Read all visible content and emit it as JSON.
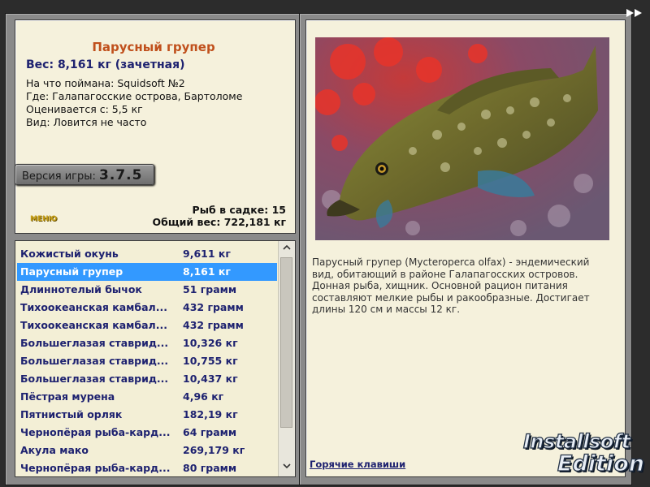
{
  "fish": {
    "title": "Парусный групер",
    "weight": "Вес: 8,161 кг (зачетная)",
    "bait": "На что поймана: Squidsoft №2",
    "place": "Где: Галапагосские острова, Бартоломе",
    "rated": "Оценивается с: 5,5 кг",
    "kind": "Вид: Ловится не часто"
  },
  "version": {
    "label": "Версия игры:",
    "number": "3.7.5"
  },
  "small_logo": "МЕНЮ",
  "stats": {
    "count": "Рыб в садке: 15",
    "total": "Общий вес: 722,181 кг"
  },
  "catch_list": [
    {
      "name": "Кожистый окунь",
      "weight": "9,611 кг"
    },
    {
      "name": "Парусный групер",
      "weight": "8,161 кг"
    },
    {
      "name": "Длиннотелый бычок",
      "weight": "51 грамм"
    },
    {
      "name": "Тихоокеанская камбал...",
      "weight": "432 грамм"
    },
    {
      "name": "Тихоокеанская камбал...",
      "weight": "432 грамм"
    },
    {
      "name": "Большеглазая ставрид...",
      "weight": "10,326 кг"
    },
    {
      "name": "Большеглазая ставрид...",
      "weight": "10,755 кг"
    },
    {
      "name": "Большеглазая ставрид...",
      "weight": "10,437 кг"
    },
    {
      "name": "Пёстрая мурена",
      "weight": "4,96 кг"
    },
    {
      "name": "Пятнистый орляк",
      "weight": "182,19 кг"
    },
    {
      "name": "Чернопёрая рыба-кард...",
      "weight": "64 грамм"
    },
    {
      "name": "Акула мако",
      "weight": "269,179 кг"
    },
    {
      "name": "Чернопёрая рыба-кард...",
      "weight": "80 грамм"
    }
  ],
  "selected_index": 1,
  "description": "Парусный групер (Mycteroperca olfax) - эндемический вид, обитающий в районе Галапагосских островов. Донная рыба, хищник. Основной рацион питания составляют мелкие рыбы и ракообразные. Достигает длины 120 см и массы 12 кг.",
  "hotkeys_link": "Горячие клавиши",
  "brand": {
    "line1": "Installsoft",
    "line2": "Edition"
  },
  "icons": {
    "forward": "fast-forward-icon",
    "scroll_up": "chevron-up-icon",
    "scroll_down": "chevron-down-icon"
  },
  "colors": {
    "panel_bg": "#f5f1dc",
    "accent_blue": "#1e2270",
    "title_orange": "#c0501c",
    "selection": "#3399ff"
  }
}
